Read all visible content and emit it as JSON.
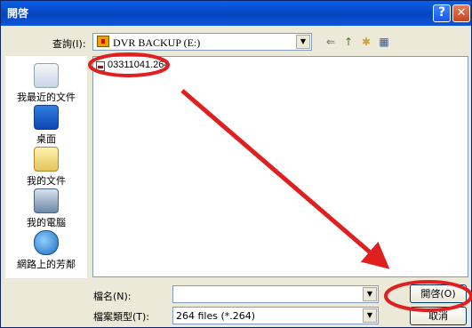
{
  "window": {
    "title": "開啓"
  },
  "lookin": {
    "label": "查詢(I):",
    "value": "DVR BACKUP (E:)"
  },
  "files": [
    {
      "name": "03311041.264"
    }
  ],
  "places": [
    {
      "label": "我最近的文件"
    },
    {
      "label": "桌面"
    },
    {
      "label": "我的文件"
    },
    {
      "label": "我的電腦"
    },
    {
      "label": "網路上的芳鄰"
    }
  ],
  "filename": {
    "label": "檔名(N):",
    "value": ""
  },
  "filetype": {
    "label": "檔案類型(T):",
    "value": "264 files (*.264)"
  },
  "buttons": {
    "open": "開啓(O)",
    "cancel": "取消"
  },
  "annotation": {
    "color": "#e02020"
  },
  "icons": {
    "help": "?",
    "close": "✕",
    "back": "⇐",
    "up": "↑",
    "new_folder": "✱",
    "views": "▦"
  }
}
